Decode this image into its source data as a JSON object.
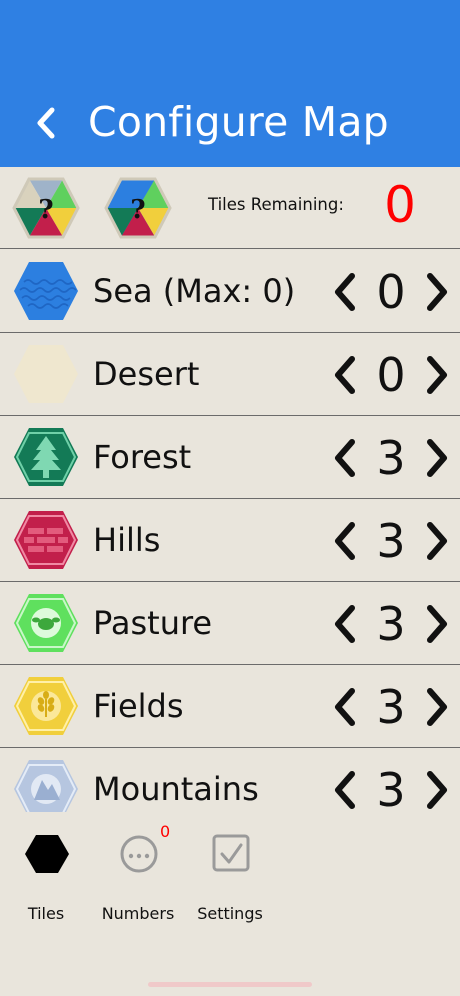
{
  "nav": {
    "title": "Configure Map",
    "back_icon": "chevron-left-icon"
  },
  "header": {
    "tiles_remaining_label": "Tiles Remaining:",
    "tiles_remaining_value": "0",
    "random_tile_label": "?",
    "random_harbor_label": "?"
  },
  "tiles": [
    {
      "name": "sea",
      "label": "Sea (Max: 0)",
      "count": "0",
      "color": "#2c7fe0",
      "icon": "waves-icon"
    },
    {
      "name": "desert",
      "label": "Desert",
      "count": "0",
      "color": "#efe7cf",
      "icon": "desert-icon"
    },
    {
      "name": "forest",
      "label": "Forest",
      "count": "3",
      "color": "#137a56",
      "icon": "tree-icon"
    },
    {
      "name": "hills",
      "label": "Hills",
      "count": "3",
      "color": "#c21f4b",
      "icon": "brick-icon"
    },
    {
      "name": "pasture",
      "label": "Pasture",
      "count": "3",
      "color": "#5fe05e",
      "icon": "sheep-icon"
    },
    {
      "name": "fields",
      "label": "Fields",
      "count": "3",
      "color": "#f1cf3c",
      "icon": "wheat-icon"
    },
    {
      "name": "mountains",
      "label": "Mountains",
      "count": "3",
      "color": "#b6c6e0",
      "icon": "mountain-icon"
    }
  ],
  "tabs": [
    {
      "label": "Tiles",
      "icon": "hexagon-icon"
    },
    {
      "label": "Numbers",
      "icon": "ellipsis-circle-icon",
      "badge": "0"
    },
    {
      "label": "Settings",
      "icon": "checkbox-icon"
    }
  ],
  "colors": {
    "nav": "#2f80e3",
    "background": "#e9e5dc",
    "alert": "#ff0000"
  }
}
